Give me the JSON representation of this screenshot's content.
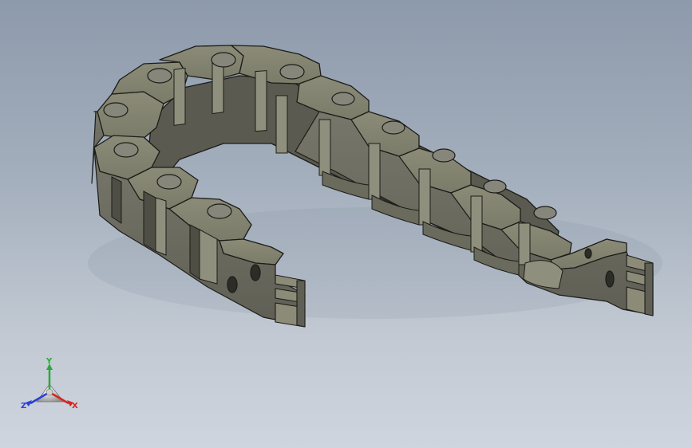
{
  "viewport": {
    "model": "cable-drag-chain",
    "background_top": "#8d9aab",
    "background_bottom": "#cfd5de",
    "part_color": "#7f7f6c"
  },
  "triad": {
    "x_label": "X",
    "y_label": "Y",
    "z_label": "Z",
    "x_color": "#d9231f",
    "y_color": "#2fa83a",
    "z_color": "#2a3fd6"
  }
}
